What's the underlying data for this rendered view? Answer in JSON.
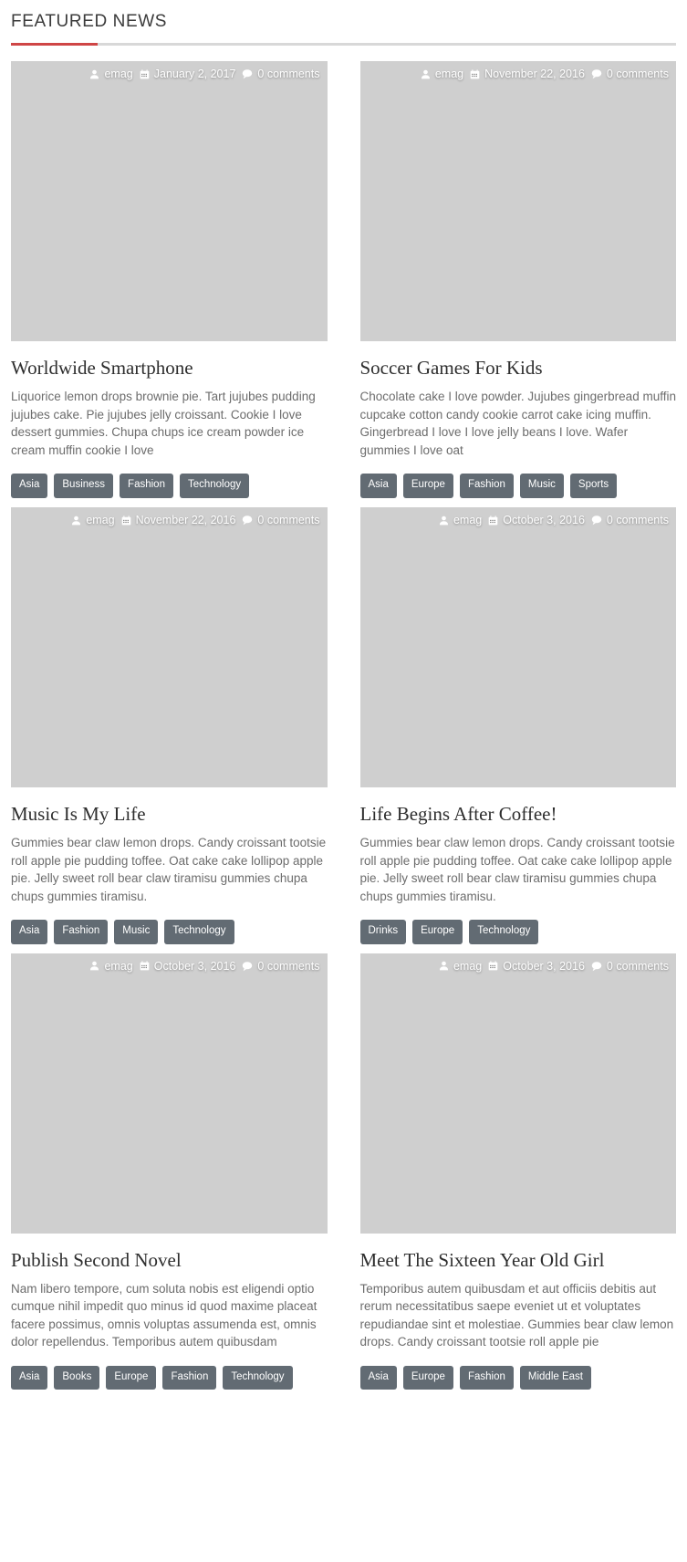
{
  "section": {
    "title": "FEATURED NEWS",
    "accent_color": "#cf4646",
    "rule_color": "#d8d8d8",
    "tag_color": "#626b73"
  },
  "icons": {
    "author": "user-icon",
    "date": "calendar-icon",
    "comments": "comment-icon"
  },
  "posts": [
    {
      "title": "Worldwide Smartphone",
      "author": "emag",
      "date": "January 2, 2017",
      "comments": "0 comments",
      "excerpt": "Liquorice lemon drops brownie pie. Tart jujubes pudding jujubes cake. Pie jujubes jelly croissant. Cookie I love dessert gummies. Chupa chups ice cream powder ice cream muffin cookie I love",
      "image": "smartphone-castle-photo",
      "tags": [
        "Asia",
        "Business",
        "Fashion",
        "Technology"
      ]
    },
    {
      "title": "Soccer Games For Kids",
      "author": "emag",
      "date": "November 22, 2016",
      "comments": "0 comments",
      "excerpt": "Chocolate cake I love powder. Jujubes gingerbread muffin cupcake cotton candy cookie carrot cake icing muffin. Gingerbread I love I love jelly beans I love. Wafer gummies I love oat",
      "image": "soccer-ball-field-photo",
      "tags": [
        "Asia",
        "Europe",
        "Fashion",
        "Music",
        "Sports"
      ]
    },
    {
      "title": "Music Is My Life",
      "author": "emag",
      "date": "November 22, 2016",
      "comments": "0 comments",
      "excerpt": "Gummies bear claw lemon drops. Candy croissant tootsie roll apple pie pudding toffee. Oat cake cake lollipop apple pie. Jelly sweet roll bear claw tiramisu gummies chupa chups gummies tiramisu.",
      "image": "woman-headphones-photo",
      "tags": [
        "Asia",
        "Fashion",
        "Music",
        "Technology"
      ]
    },
    {
      "title": "Life Begins After Coffee!",
      "author": "emag",
      "date": "October 3, 2016",
      "comments": "0 comments",
      "excerpt": "Gummies bear claw lemon drops. Candy croissant tootsie roll apple pie pudding toffee. Oat cake cake lollipop apple pie. Jelly sweet roll bear claw tiramisu gummies chupa chups gummies tiramisu.",
      "image": "coffee-cup-beans-photo",
      "tags": [
        "Drinks",
        "Europe",
        "Technology"
      ]
    },
    {
      "title": "Publish Second Novel",
      "author": "emag",
      "date": "October 3, 2016",
      "comments": "0 comments",
      "excerpt": "Nam libero tempore, cum soluta nobis est eligendi optio cumque nihil impedit quo minus id quod maxime placeat facere possimus, omnis voluptas assumenda est, omnis dolor repellendus. Temporibus autem quibusdam",
      "image": "writing-notebook-photo",
      "tags": [
        "Asia",
        "Books",
        "Europe",
        "Fashion",
        "Technology"
      ]
    },
    {
      "title": "Meet The Sixteen Year Old Girl",
      "author": "emag",
      "date": "October 3, 2016",
      "comments": "0 comments",
      "excerpt": "Temporibus autem quibusdam et aut officiis debitis aut rerum necessitatibus saepe eveniet ut et voluptates repudiandae sint et molestiae. Gummies bear claw lemon drops. Candy croissant tootsie roll apple pie",
      "image": "woman-suitcase-path-photo",
      "tags": [
        "Asia",
        "Europe",
        "Fashion",
        "Middle East"
      ]
    }
  ]
}
